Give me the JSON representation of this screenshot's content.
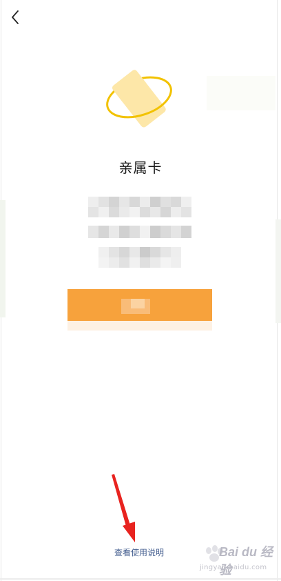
{
  "page": {
    "title": "亲属卡",
    "help_link": "查看使用说明"
  },
  "icons": {
    "back": "chevron-left-icon",
    "hero": "orbit-card-icon"
  },
  "colors": {
    "accent": "#f7a23c",
    "card": "#fde7a8",
    "orbit": "#f2c200",
    "link": "#3f5a8c",
    "annotation": "#e8231f"
  },
  "watermark": {
    "brand": "Bai du 经验",
    "url": "jingyan.baidu.com"
  }
}
